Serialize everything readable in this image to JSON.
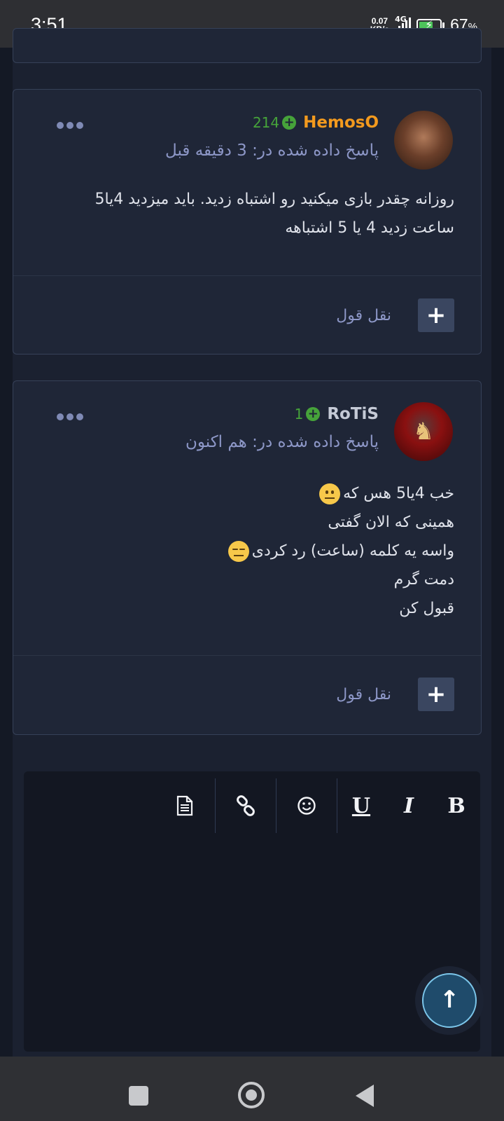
{
  "status_bar": {
    "time": "3:51",
    "net_speed_value": "0.07",
    "net_speed_unit": "KB/s",
    "network": "4G",
    "battery_percent": "67",
    "battery_unit": "%"
  },
  "posts": [
    {
      "author": "HemosO",
      "author_color": "#f39a1e",
      "reputation": "214",
      "time_text": "پاسخ داده شده در: 3 دقیقه قبل",
      "body_lines": [
        "روزانه چقدر بازی میکنید رو اشتباه زدید. باید میزدید 4یا5",
        "ساعت زدید 4 یا 5 اشتباهه"
      ],
      "quote_label": "نقل قول",
      "quote_button": "+"
    },
    {
      "author": "RoTiS",
      "author_color": "#c5cad6",
      "reputation": "1",
      "time_text": "پاسخ داده شده در: هم اکنون",
      "body_lines": [
        "خب 4یا5 هس که",
        "همینی که الان گفتی",
        "واسه یه کلمه (ساعت) رد کردی",
        "دمت گرم",
        "قبول کن"
      ],
      "quote_label": "نقل قول",
      "quote_button": "+"
    }
  ],
  "editor_toolbar": {
    "bold": "B",
    "italic": "I",
    "underline": "U",
    "emoji_icon": "smiley-icon",
    "link_icon": "link-icon",
    "document_icon": "document-icon"
  },
  "scroll_top_icon": "↑"
}
